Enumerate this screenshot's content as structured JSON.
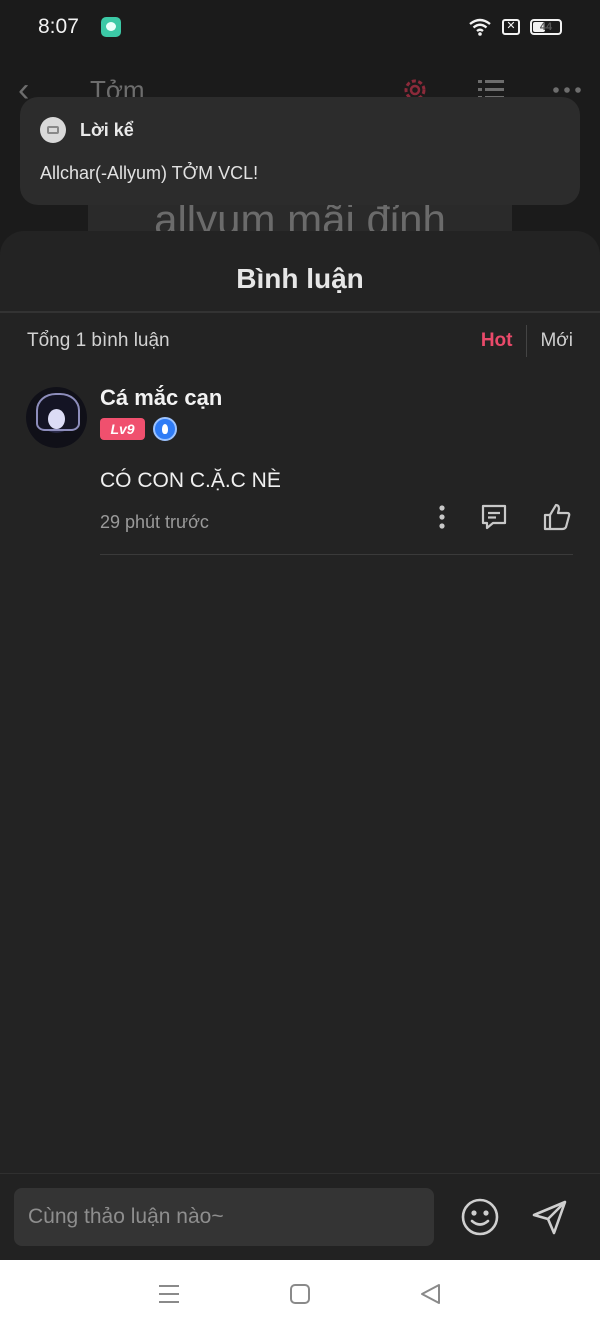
{
  "status_bar": {
    "time": "8:07",
    "battery": "44"
  },
  "background": {
    "title": "Tởm",
    "text_preview": "allyum mãi đỉnh"
  },
  "notification": {
    "title": "Lời kể",
    "body": "Allchar(-Allyum) TỞM VCL!"
  },
  "comments_sheet": {
    "title": "Bình luận",
    "total": "Tổng 1 bình luận",
    "sort_hot": "Hot",
    "sort_new": "Mới",
    "comments": [
      {
        "username": "Cá mắc cạn",
        "level": "Lv9",
        "text": "CÓ CON C.Ặ.C NÈ",
        "time": "29 phút trước"
      }
    ]
  },
  "input": {
    "placeholder": "Cùng thảo luận nào~"
  },
  "colors": {
    "accent": "#e94a6a",
    "level_badge": "#f0506e",
    "verified": "#2f7cf6"
  }
}
